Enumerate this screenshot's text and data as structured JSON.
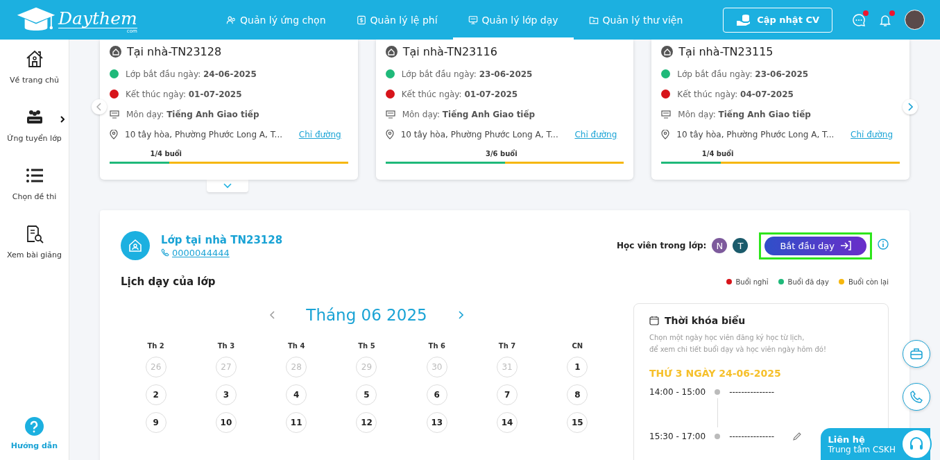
{
  "header": {
    "logo": "Daythem",
    "logo_sub": "com",
    "nav": [
      {
        "label": "Quản lý ứng chọn",
        "selected": false
      },
      {
        "label": "Quản lý lệ phí",
        "selected": false
      },
      {
        "label": "Quản lý lớp dạy",
        "selected": true
      },
      {
        "label": "Quản lý thư viện",
        "selected": false
      }
    ],
    "cv_button": "Cập nhật CV",
    "chat_unread": true,
    "notify_unread": true
  },
  "sidebar": {
    "items": [
      {
        "label": "Về trang chủ",
        "has_submenu": false
      },
      {
        "label": "Ứng tuyển lớp",
        "has_submenu": true
      },
      {
        "label": "Chọn đề thi",
        "has_submenu": false
      },
      {
        "label": "Xem bài giảng",
        "has_submenu": false
      }
    ],
    "help": "Hướng dẫn"
  },
  "class_cards": [
    {
      "title": "Tại nhà-TN23128",
      "start_label": "Lớp bắt đầu ngày:",
      "start": "24-06-2025",
      "end_label": "Kết thúc ngày:",
      "end": "01-07-2025",
      "subject_label": "Môn dạy:",
      "subject": "Tiếng Anh Giao tiếp",
      "address": "10 tây hòa, Phường Phước Long A, T...",
      "directions": "Chỉ đường",
      "progress": "1/4 buổi",
      "level": 0.25,
      "expanded": true
    },
    {
      "title": "Tại nhà-TN23116",
      "start_label": "Lớp bắt đầu ngày:",
      "start": "23-06-2025",
      "end_label": "Kết thúc ngày:",
      "end": "01-07-2025",
      "subject_label": "Môn dạy:",
      "subject": "Tiếng Anh Giao tiếp",
      "address": "10 tây hòa, Phường Phước Long A, T...",
      "directions": "Chỉ đường",
      "progress": "3/6 buổi",
      "level": 0.5,
      "expanded": false
    },
    {
      "title": "Tại nhà-TN23115",
      "start_label": "Lớp bắt đầu ngày:",
      "start": "23-06-2025",
      "end_label": "Kết thúc ngày:",
      "end": "04-07-2025",
      "subject_label": "Môn dạy:",
      "subject": "Tiếng Anh Giao tiếp",
      "address": "10 tây hòa, Phường Phước Long A, T...",
      "directions": "Chỉ đường",
      "progress": "1/4 buổi",
      "level": 0.25,
      "expanded": false
    }
  ],
  "class_detail": {
    "title": "Lớp tại nhà TN23128",
    "phone": "0000044444",
    "students_label": "Học viên trong lớp:",
    "students": [
      {
        "initial": "N",
        "color": "#7d5a9c"
      },
      {
        "initial": "T",
        "color": "#1b5b6b"
      }
    ],
    "start_button": "Bắt đầu dạy",
    "schedule_title": "Lịch dạy của lớp",
    "legend": [
      {
        "label": "Buổi nghỉ",
        "color": "#d7141a"
      },
      {
        "label": "Buổi đã dạy",
        "color": "#1fb97a"
      },
      {
        "label": "Buổi còn lại",
        "color": "#f6b70e"
      }
    ],
    "calendar": {
      "month": "Tháng 06 2025",
      "weekdays": [
        "Th 2",
        "Th 3",
        "Th 4",
        "Th 5",
        "Th 6",
        "Th 7",
        "CN"
      ],
      "days": [
        {
          "label": "26",
          "other_month": true
        },
        {
          "label": "27",
          "other_month": true
        },
        {
          "label": "28",
          "other_month": true
        },
        {
          "label": "29",
          "other_month": true
        },
        {
          "label": "30",
          "other_month": true
        },
        {
          "label": "31",
          "other_month": true
        },
        {
          "label": "1",
          "other_month": false
        },
        {
          "label": "2",
          "other_month": false
        },
        {
          "label": "3",
          "other_month": false
        },
        {
          "label": "4",
          "other_month": false
        },
        {
          "label": "5",
          "other_month": false
        },
        {
          "label": "6",
          "other_month": false
        },
        {
          "label": "7",
          "other_month": false
        },
        {
          "label": "8",
          "other_month": false
        },
        {
          "label": "9",
          "other_month": false
        },
        {
          "label": "10",
          "other_month": false
        },
        {
          "label": "11",
          "other_month": false
        },
        {
          "label": "12",
          "other_month": false
        },
        {
          "label": "13",
          "other_month": false
        },
        {
          "label": "14",
          "other_month": false
        },
        {
          "label": "15",
          "other_month": false
        }
      ]
    },
    "timetable": {
      "title": "Thời khóa biểu",
      "hint": "Chọn một ngày học viên đăng ký học từ lịch,\nđể xem chi tiết buổi dạy và học viên ngày hôm đó!",
      "date": "THỨ 3 NGÀY 24-06-2025",
      "slots": [
        {
          "time": "14:00 - 15:00",
          "text": "---------------",
          "editable": false
        },
        {
          "time": "15:30 - 17:00",
          "text": "---------------",
          "editable": true
        }
      ]
    }
  },
  "contact": {
    "title": "Liên hệ",
    "subtitle": "Trung tâm CSKH"
  }
}
